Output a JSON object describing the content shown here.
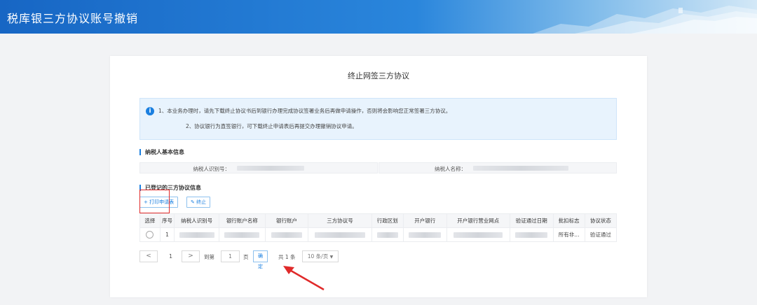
{
  "header": {
    "title": "税库银三方协议账号撤销"
  },
  "card": {
    "title": "终止网签三方协议",
    "notice": {
      "line1": "1、本业务办理时，请先下载终止协议书后到银行办理完成协议签署业务后再做申请操作，否则将会影响您正常签署三方协议。",
      "line2": "2、协议银行为直签银行，可下载终止申请表后再提交办理撤销协议申请。"
    },
    "basic_info": {
      "section_title": "纳税人基本信息",
      "taxpayer_id_label": "纳税人识别号：",
      "taxpayer_name_label": "纳税人名称："
    },
    "agreements": {
      "section_title": "已登记的三方协议信息",
      "print_button": "+ 打印申请表",
      "terminate_button": "✎ 终止",
      "columns": [
        "选择",
        "序号",
        "纳税人识别号",
        "银行账户名称",
        "银行账户",
        "三方协议号",
        "行政区划",
        "开户银行",
        "开户银行营业网点",
        "验证通过日期",
        "批扣标志",
        "协议状态"
      ],
      "rows": [
        {
          "seq": "1",
          "deduct_flag": "所有非...",
          "status": "验证通过"
        }
      ]
    },
    "pagination": {
      "prev": "<",
      "page": "1",
      "next": ">",
      "goto_label": "到第",
      "goto_value": "1",
      "page_unit": "页",
      "confirm_button": "确定",
      "total": "共 1 条",
      "page_size": "10 条/页"
    }
  },
  "colors": {
    "accent": "#1a7fe0",
    "highlight": "#e02a2a"
  }
}
